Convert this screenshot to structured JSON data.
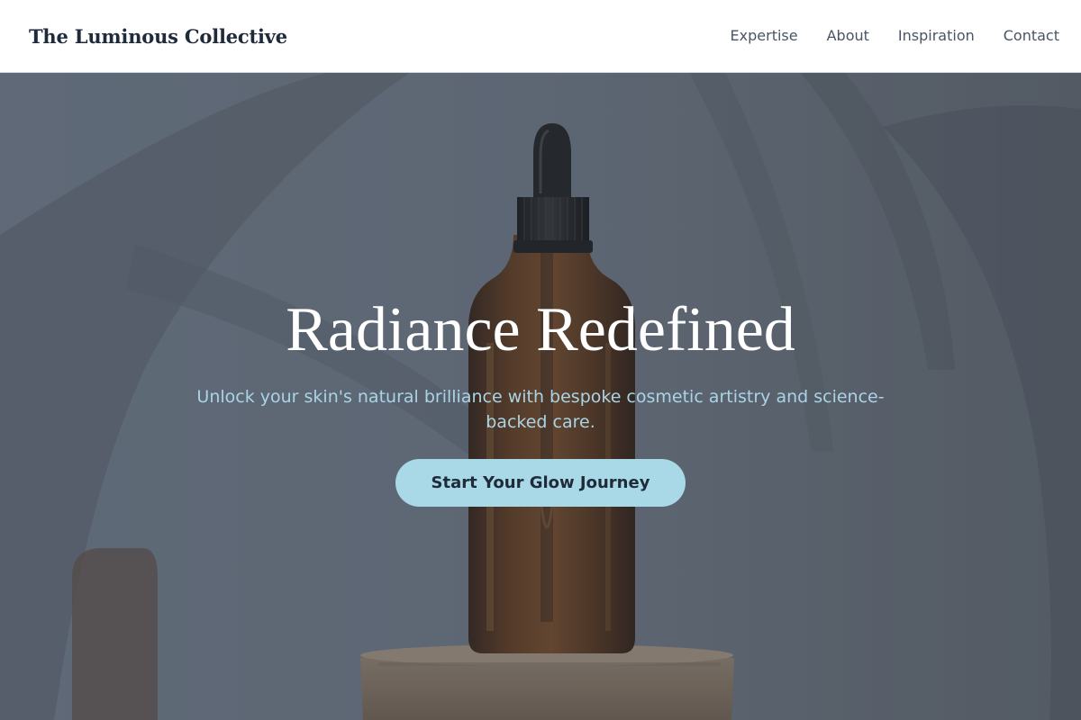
{
  "header": {
    "logo": "The Luminous Collective",
    "nav": [
      {
        "label": "Expertise"
      },
      {
        "label": "About"
      },
      {
        "label": "Inspiration"
      },
      {
        "label": "Contact"
      }
    ]
  },
  "hero": {
    "title": "Radiance Redefined",
    "subtitle": "Unlock your skin's natural brilliance with bespoke cosmetic artistry and science-backed care.",
    "cta_label": "Start Your Glow Journey",
    "image_label": "amber-dropper-bottle-photo",
    "colors": {
      "overlay": "#5c6470",
      "subtitle": "#aad4e6",
      "cta_background": "#a9d8e6",
      "text_dark": "#1f2a3a"
    }
  }
}
